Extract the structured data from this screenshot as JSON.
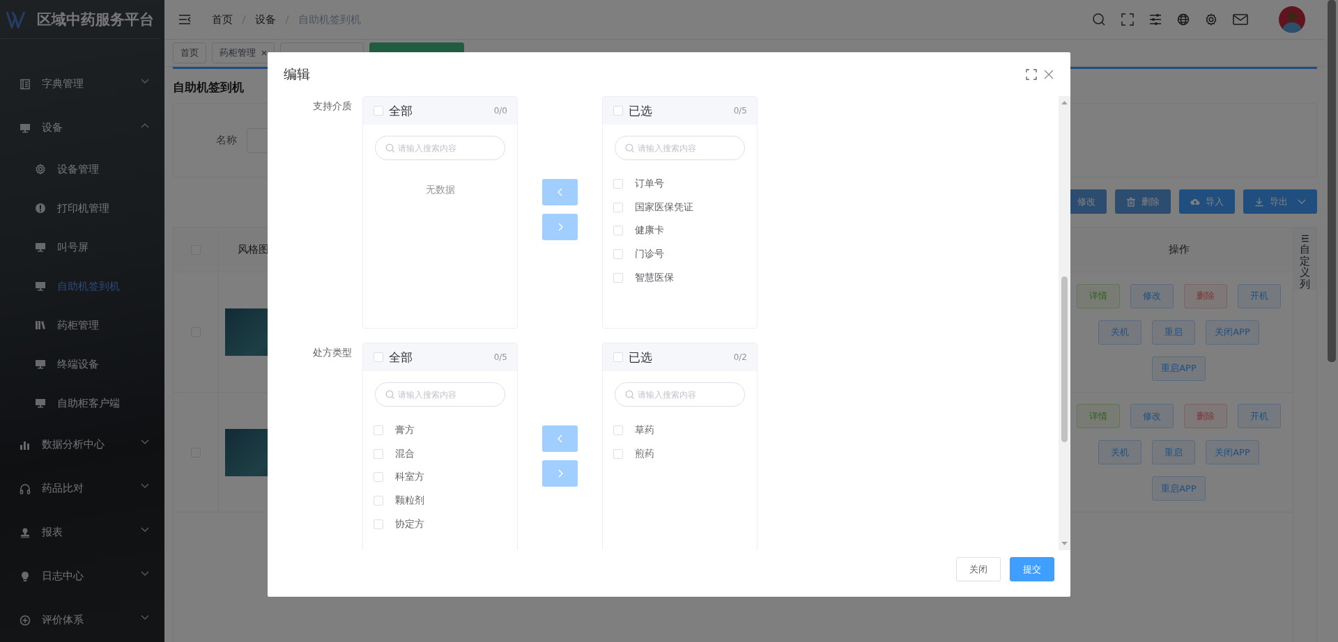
{
  "sidebar": {
    "title": "区域中药服务平台",
    "items": [
      {
        "label": "字典管理",
        "expanded": false,
        "selected": false
      },
      {
        "label": "设备",
        "expanded": true,
        "selected": false,
        "children": [
          {
            "label": "设备管理",
            "selected": false
          },
          {
            "label": "打印机管理",
            "selected": false
          },
          {
            "label": "叫号屏",
            "selected": false
          },
          {
            "label": "自助机签到机",
            "selected": true
          },
          {
            "label": "药柜管理",
            "selected": false
          },
          {
            "label": "终端设备",
            "selected": false
          },
          {
            "label": "自助柜客户端",
            "selected": false
          }
        ]
      },
      {
        "label": "数据分析中心",
        "expanded": false,
        "selected": false
      },
      {
        "label": "药品比对",
        "expanded": false,
        "selected": false
      },
      {
        "label": "报表",
        "expanded": false,
        "selected": false
      },
      {
        "label": "日志中心",
        "expanded": false,
        "selected": false
      },
      {
        "label": "评价体系",
        "expanded": false,
        "selected": false
      }
    ]
  },
  "header": {
    "breadcrumb": [
      "首页",
      "设备",
      "自助机签到机"
    ]
  },
  "tags": [
    {
      "label": "首页",
      "closable": false,
      "selected": false
    },
    {
      "label": "药柜管理",
      "closable": true,
      "selected": false
    },
    {
      "selected": false
    },
    {
      "selected": true
    }
  ],
  "page": {
    "title": "自助机签到机",
    "search": {
      "label": "名称"
    },
    "toolbar": [
      {
        "label": "修改",
        "disabled": true
      },
      {
        "label": "删除",
        "disabled": true
      },
      {
        "label": "导入",
        "disabled": false
      },
      {
        "label": "导出",
        "disabled": false,
        "dropdown": true
      }
    ],
    "table": {
      "header_checked": false,
      "columns": [
        "风格图",
        "操作"
      ],
      "rows": [
        {
          "checked": false,
          "actions": [
            {
              "label": "详情",
              "kind": "success"
            },
            {
              "label": "修改",
              "kind": "primary"
            },
            {
              "label": "删除",
              "kind": "danger"
            },
            {
              "label": "开机",
              "kind": "primary"
            },
            {
              "label": "关机",
              "kind": "primary"
            },
            {
              "label": "重启",
              "kind": "primary"
            },
            {
              "label": "关闭APP",
              "kind": "primary"
            },
            {
              "label": "重启APP",
              "kind": "primary"
            }
          ]
        },
        {
          "checked": false,
          "actions": [
            {
              "label": "详情",
              "kind": "success"
            },
            {
              "label": "修改",
              "kind": "primary"
            },
            {
              "label": "删除",
              "kind": "danger"
            },
            {
              "label": "开机",
              "kind": "primary"
            },
            {
              "label": "关机",
              "kind": "primary"
            },
            {
              "label": "重启",
              "kind": "primary"
            },
            {
              "label": "关闭APP",
              "kind": "primary"
            },
            {
              "label": "重启APP",
              "kind": "primary"
            }
          ]
        }
      ]
    },
    "custom_columns": "自定义列"
  },
  "modal": {
    "title": "编辑",
    "fields": [
      {
        "label": "支持介质",
        "transfer": {
          "source": {
            "title": "全部",
            "checked": false,
            "count": "0/0",
            "placeholder": "请输入搜索内容",
            "empty_text": "无数据"
          },
          "move_buttons": [
            {
              "disabled": true
            },
            {
              "disabled": true
            }
          ],
          "target": {
            "title": "已选",
            "checked": false,
            "count": "0/5",
            "placeholder": "请输入搜索内容",
            "items": [
              {
                "label": "订单号",
                "checked": false
              },
              {
                "label": "国家医保凭证",
                "checked": false
              },
              {
                "label": "健康卡",
                "checked": false
              },
              {
                "label": "门诊号",
                "checked": false
              },
              {
                "label": "智慧医保",
                "checked": false
              }
            ]
          }
        }
      },
      {
        "label": "处方类型",
        "transfer": {
          "source": {
            "title": "全部",
            "checked": false,
            "count": "0/5",
            "placeholder": "请输入搜索内容",
            "items": [
              {
                "label": "膏方",
                "checked": false
              },
              {
                "label": "混合",
                "checked": false
              },
              {
                "label": "科室方",
                "checked": false
              },
              {
                "label": "颗粒剂",
                "checked": false
              },
              {
                "label": "协定方",
                "checked": false
              }
            ]
          },
          "move_buttons": [
            {
              "disabled": true
            },
            {
              "disabled": true
            }
          ],
          "target": {
            "title": "已选",
            "checked": false,
            "count": "0/2",
            "placeholder": "请输入搜索内容",
            "items": [
              {
                "label": "草药",
                "checked": false
              },
              {
                "label": "煎药",
                "checked": false
              }
            ]
          }
        }
      }
    ],
    "buttons": [
      {
        "label": "关闭",
        "kind": "default"
      },
      {
        "label": "提交",
        "kind": "primary"
      }
    ]
  }
}
